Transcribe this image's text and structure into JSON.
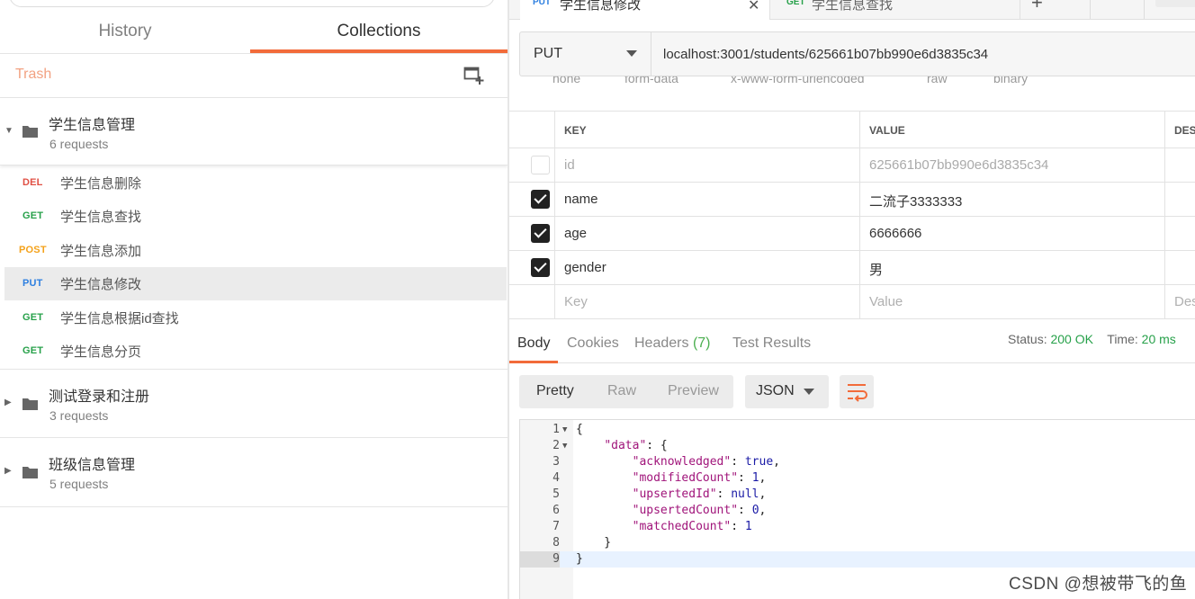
{
  "colors": {
    "accent": "#F26B3A",
    "get": "#27A14A",
    "put": "#2D7FE0",
    "post": "#F4A21B",
    "del": "#E04F43",
    "status_ok": "#27A14A"
  },
  "sidebar": {
    "tabs": [
      {
        "label": "History",
        "active": false
      },
      {
        "label": "Collections",
        "active": true
      }
    ],
    "trash_label": "Trash",
    "new_collection_icon": "folder-plus-icon",
    "collections": [
      {
        "name": "学生信息管理",
        "count": "6 requests",
        "expanded": true,
        "requests": [
          {
            "method": "DEL",
            "name": "学生信息删除",
            "active": false
          },
          {
            "method": "GET",
            "name": "学生信息查找",
            "active": false
          },
          {
            "method": "POST",
            "name": "学生信息添加",
            "active": false
          },
          {
            "method": "PUT",
            "name": "学生信息修改",
            "active": true
          },
          {
            "method": "GET",
            "name": "学生信息根据id查找",
            "active": false
          },
          {
            "method": "GET",
            "name": "学生信息分页",
            "active": false
          }
        ]
      },
      {
        "name": "测试登录和注册",
        "count": "3 requests",
        "expanded": false
      },
      {
        "name": "班级信息管理",
        "count": "5 requests",
        "expanded": false
      }
    ]
  },
  "request_tabs": [
    {
      "method": "PUT",
      "name": "学生信息修改",
      "active": true
    },
    {
      "method": "GET",
      "name": "学生信息查找",
      "active": false
    }
  ],
  "request": {
    "method": "PUT",
    "url": "localhost:3001/students/625661b07bb990e6d3835c34",
    "body_modes": [
      "none",
      "form-data",
      "x-www-form-urlencoded",
      "raw",
      "binary"
    ],
    "params": {
      "headers": [
        "KEY",
        "VALUE",
        "DESC"
      ],
      "rows": [
        {
          "checked": false,
          "key": "id",
          "value": "625661b07bb990e6d3835c34"
        },
        {
          "checked": true,
          "key": "name",
          "value": "二流子3333333"
        },
        {
          "checked": true,
          "key": "age",
          "value": "6666666"
        },
        {
          "checked": true,
          "key": "gender",
          "value": "男"
        }
      ],
      "placeholder": {
        "key": "Key",
        "value": "Value",
        "desc": "Des"
      }
    }
  },
  "response": {
    "tabs": [
      "Body",
      "Cookies",
      "Headers",
      "Test Results"
    ],
    "headers_count": "(7)",
    "status_label": "Status:",
    "status_value": "200 OK",
    "time_label": "Time:",
    "time_value": "20 ms",
    "view_modes": [
      "Pretty",
      "Raw",
      "Preview"
    ],
    "format": "JSON",
    "wrap_icon": "wrap-lines-icon",
    "code_lines": [
      {
        "n": "1",
        "fold": true,
        "text": "{"
      },
      {
        "n": "2",
        "fold": true,
        "text": "    \"data\": {"
      },
      {
        "n": "3",
        "fold": false,
        "text": "        \"acknowledged\": true,"
      },
      {
        "n": "4",
        "fold": false,
        "text": "        \"modifiedCount\": 1,"
      },
      {
        "n": "5",
        "fold": false,
        "text": "        \"upsertedId\": null,"
      },
      {
        "n": "6",
        "fold": false,
        "text": "        \"upsertedCount\": 0,"
      },
      {
        "n": "7",
        "fold": false,
        "text": "        \"matchedCount\": 1"
      },
      {
        "n": "8",
        "fold": false,
        "text": "    }"
      },
      {
        "n": "9",
        "fold": false,
        "text": "}"
      }
    ]
  },
  "watermark": "CSDN @想被带飞的鱼"
}
